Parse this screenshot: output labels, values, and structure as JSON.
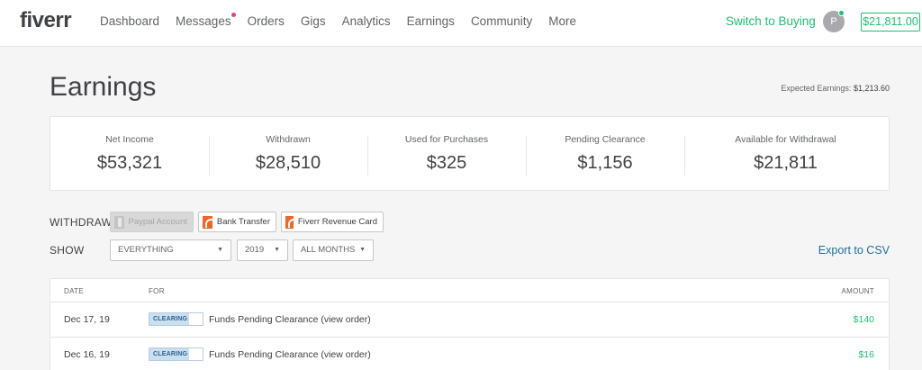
{
  "header": {
    "logo": "fiverr",
    "nav": [
      {
        "label": "Dashboard",
        "notification": false
      },
      {
        "label": "Messages",
        "notification": true
      },
      {
        "label": "Orders",
        "notification": false
      },
      {
        "label": "Gigs",
        "notification": false
      },
      {
        "label": "Analytics",
        "notification": false
      },
      {
        "label": "Earnings",
        "notification": false
      },
      {
        "label": "Community",
        "notification": false
      },
      {
        "label": "More",
        "notification": false
      }
    ],
    "switch_label": "Switch to Buying",
    "avatar_initial": "P",
    "balance": "$21,811.00"
  },
  "page": {
    "title": "Earnings",
    "expected_label": "Expected Earnings:",
    "expected_value": "$1,213.60"
  },
  "stats": [
    {
      "label": "Net Income",
      "value": "$53,321"
    },
    {
      "label": "Withdrawn",
      "value": "$28,510"
    },
    {
      "label": "Used for Purchases",
      "value": "$325"
    },
    {
      "label": "Pending Clearance",
      "value": "$1,156"
    },
    {
      "label": "Available for Withdrawal",
      "value": "$21,811"
    }
  ],
  "withdraw": {
    "label": "WITHDRAW",
    "options": [
      {
        "label": "Paypal Account",
        "icon": "paypal-icon",
        "enabled": false
      },
      {
        "label": "Bank Transfer",
        "icon": "bank-transfer-icon",
        "enabled": true
      },
      {
        "label": "Fiverr Revenue Card",
        "icon": "revenue-card-icon",
        "enabled": true
      }
    ]
  },
  "show": {
    "label": "SHOW",
    "type_filter": "EVERYTHING",
    "year_filter": "2019",
    "month_filter": "ALL MONTHS",
    "export_label": "Export to CSV"
  },
  "table": {
    "columns": {
      "date": "DATE",
      "for": "FOR",
      "amount": "AMOUNT"
    },
    "rows": [
      {
        "date": "Dec 17, 19",
        "status": "CLEARING",
        "description": "Funds Pending Clearance (view order)",
        "amount": "$140"
      },
      {
        "date": "Dec 16, 19",
        "status": "CLEARING",
        "description": "Funds Pending Clearance (view order)",
        "amount": "$16"
      }
    ]
  },
  "colors": {
    "accent_green": "#1dbf73",
    "link_blue": "#1f6f9e",
    "notification_pink": "#e0457b",
    "card_orange": "#f26522"
  }
}
